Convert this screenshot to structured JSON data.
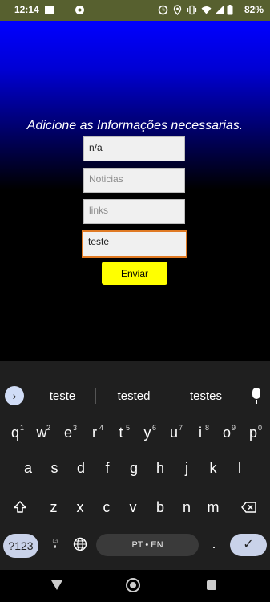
{
  "status_bar": {
    "time": "12:14",
    "battery": "82%",
    "icons": [
      "notification-square-icon",
      "radio-icon",
      "clock-icon",
      "location-icon",
      "vibrate-icon",
      "wifi-icon",
      "signal-icon",
      "battery-icon"
    ]
  },
  "app": {
    "title": "Adicione as Informações necessarias.",
    "fields": {
      "field1_value": "n/a",
      "field2_placeholder": "Noticias",
      "field3_placeholder": "links",
      "field4_value": "teste"
    },
    "send_label": "Enviar",
    "colors": {
      "gradient_top": "#0000ff",
      "button": "#ffff00",
      "focus_border": "#e07a24"
    }
  },
  "keyboard": {
    "suggestions": [
      "teste",
      "tested",
      "testes"
    ],
    "row1": [
      {
        "k": "q",
        "n": "1"
      },
      {
        "k": "w",
        "n": "2"
      },
      {
        "k": "e",
        "n": "3"
      },
      {
        "k": "r",
        "n": "4"
      },
      {
        "k": "t",
        "n": "5"
      },
      {
        "k": "y",
        "n": "6"
      },
      {
        "k": "u",
        "n": "7"
      },
      {
        "k": "i",
        "n": "8"
      },
      {
        "k": "o",
        "n": "9"
      },
      {
        "k": "p",
        "n": "0"
      }
    ],
    "row2": [
      "a",
      "s",
      "d",
      "f",
      "g",
      "h",
      "j",
      "k",
      "l"
    ],
    "row3": [
      "z",
      "x",
      "c",
      "v",
      "b",
      "n",
      "m"
    ],
    "symbols_label": "?123",
    "comma": ",",
    "space_label": "PT • EN",
    "period": ".",
    "enter_icon": "✓"
  }
}
